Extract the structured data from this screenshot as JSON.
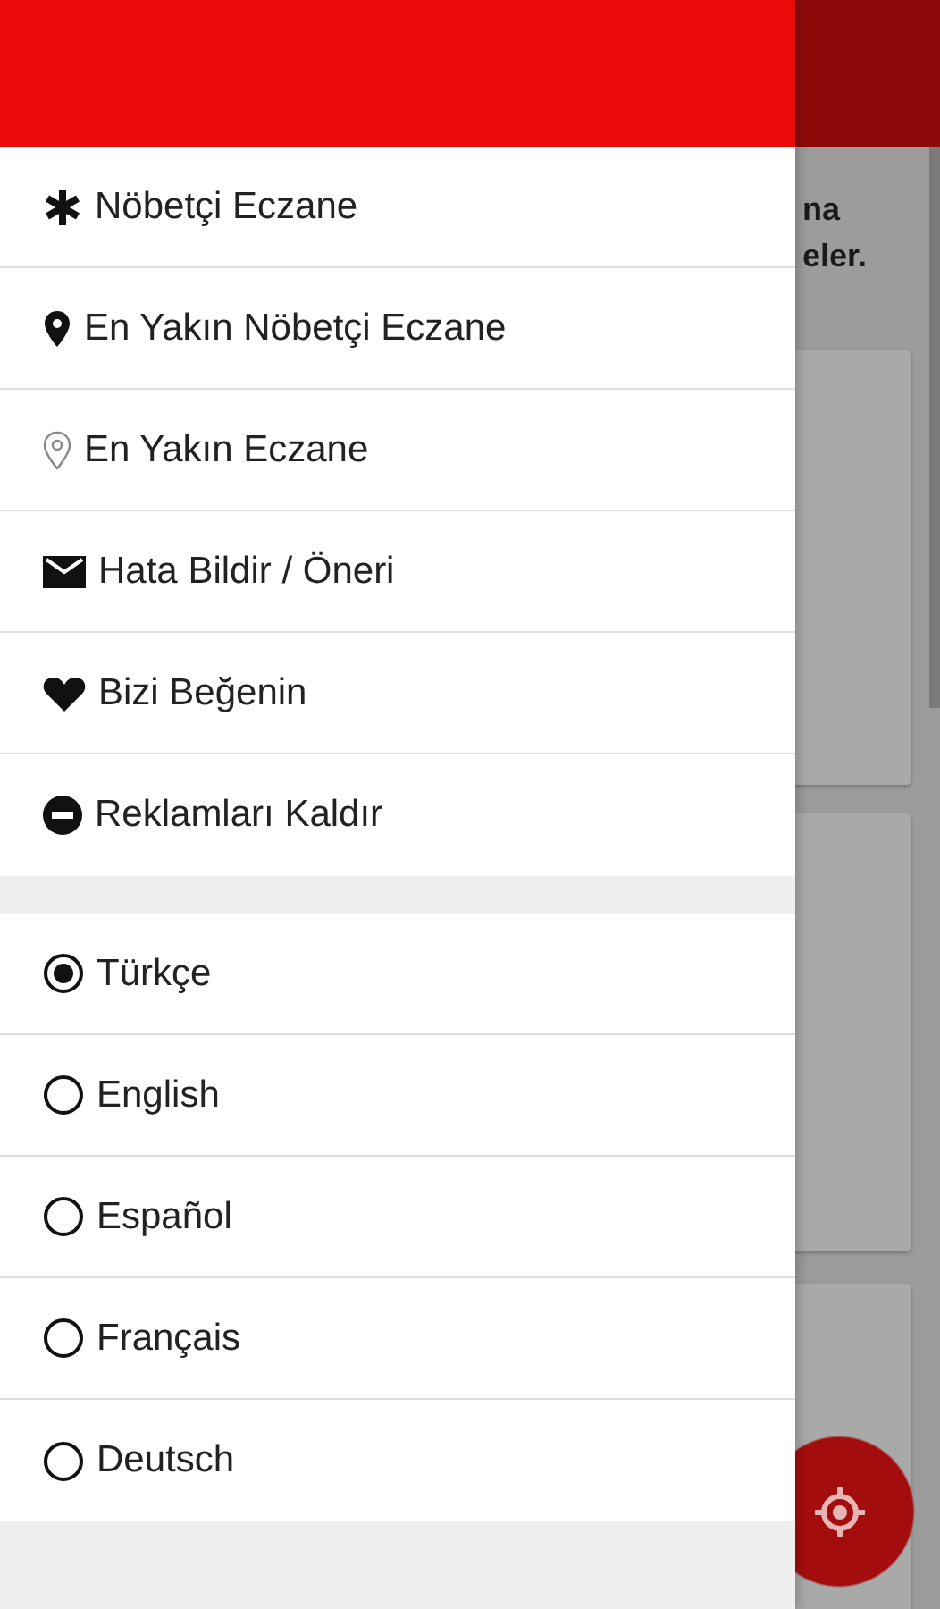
{
  "background": {
    "partial_text": [
      "na",
      "eler."
    ]
  },
  "menu": [
    {
      "label": "Nöbetçi Eczane"
    },
    {
      "label": "En Yakın Nöbetçi Eczane"
    },
    {
      "label": "En Yakın Eczane"
    },
    {
      "label": "Hata Bildir / Öneri"
    },
    {
      "label": "Bizi Beğenin"
    },
    {
      "label": "Reklamları Kaldır"
    }
  ],
  "languages": [
    {
      "label": "Türkçe",
      "selected": true
    },
    {
      "label": "English",
      "selected": false
    },
    {
      "label": "Español",
      "selected": false
    },
    {
      "label": "Français",
      "selected": false
    },
    {
      "label": "Deutsch",
      "selected": false
    }
  ]
}
